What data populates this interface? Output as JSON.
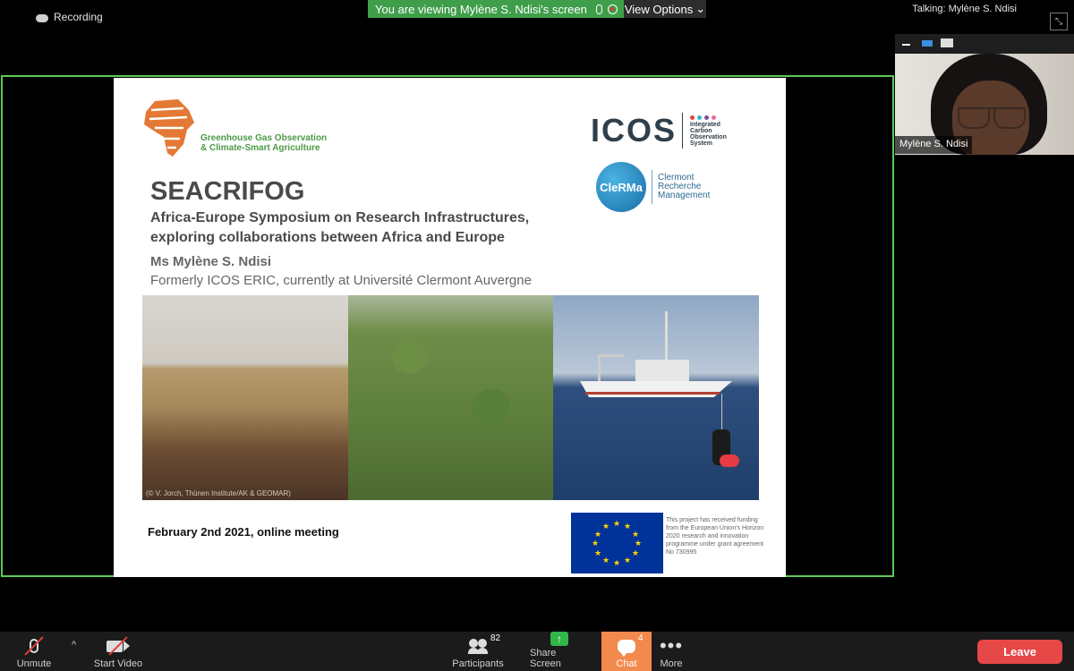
{
  "top_bar": {
    "recording_label": "Recording",
    "viewing_banner": "You are viewing Mylène S. Ndisi's screen",
    "view_options_label": "View Options",
    "talking_label": "Talking: Mylène S. Ndisi"
  },
  "slide": {
    "seacrifog_logo_text": "SEACRIFOG",
    "logo_caption_line1": "Greenhouse Gas Observation",
    "logo_caption_line2": "& Climate-Smart Agriculture",
    "icos_word": "ICOS",
    "icos_sub": [
      "Integrated",
      "Carbon",
      "Observation",
      "System"
    ],
    "icos_dot_colors": [
      "#e2453c",
      "#3bb7c4",
      "#7d4fa1",
      "#e86ca2"
    ],
    "clerma_circle": "CleRMa",
    "clerma_text": [
      "Clermont",
      "Recherche",
      "Management"
    ],
    "title": "SEACRIFOG",
    "subtitle_line1": "Africa-Europe Symposium on Research Infrastructures,",
    "subtitle_line2": "exploring collaborations between Africa and Europe",
    "presenter_name": "Ms Mylène S. Ndisi",
    "presenter_affiliation": "Formerly ICOS ERIC, currently at Université Clermont Auvergne",
    "photo_credit": "(© V. Jorch, Thünen Institute/AK & GEOMAR)",
    "meeting_date": "February 2nd 2021, online meeting",
    "eu_funding_text": "This project has received funding from the European Union's Horizon 2020 research and innovation programme under grant agreement No 730995"
  },
  "participant": {
    "name": "Mylène S. Ndisi"
  },
  "toolbar": {
    "unmute_label": "Unmute",
    "start_video_label": "Start Video",
    "participants_label": "Participants",
    "participants_count": "82",
    "share_screen_label": "Share Screen",
    "chat_label": "Chat",
    "chat_count": "4",
    "more_label": "More",
    "leave_label": "Leave"
  },
  "colors": {
    "share_border": "#5dc957",
    "banner_green": "#3f9e4a",
    "chat_orange": "#f2894d",
    "leave_red": "#e64747",
    "eu_blue": "#003399"
  }
}
